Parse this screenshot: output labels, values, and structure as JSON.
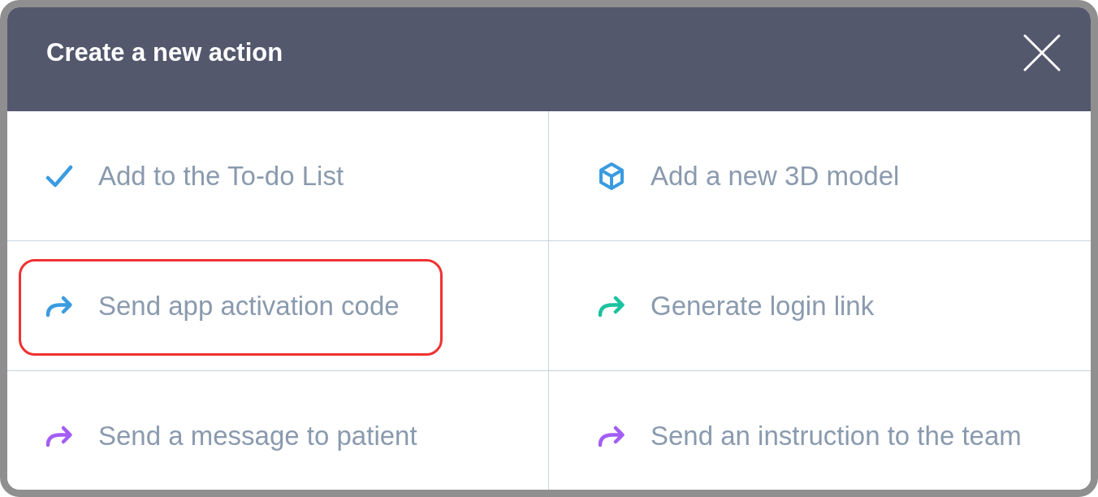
{
  "dialog": {
    "title": "Create a new action"
  },
  "actions": [
    {
      "label": "Add to the To-do List",
      "kind": "check",
      "color": "#3a9be0",
      "highlighted": false
    },
    {
      "label": "Add a new 3D model",
      "kind": "cube",
      "color": "#3a9be0",
      "highlighted": false
    },
    {
      "label": "Send app activation code",
      "kind": "arrow",
      "color": "#3a9be0",
      "highlighted": true
    },
    {
      "label": "Generate login link",
      "kind": "arrow",
      "color": "#1cc29f",
      "highlighted": false
    },
    {
      "label": "Send a message to patient",
      "kind": "arrow",
      "color": "#a35ef5",
      "highlighted": false
    },
    {
      "label": "Send an instruction to the team",
      "kind": "arrow",
      "color": "#a35ef5",
      "highlighted": false
    }
  ]
}
